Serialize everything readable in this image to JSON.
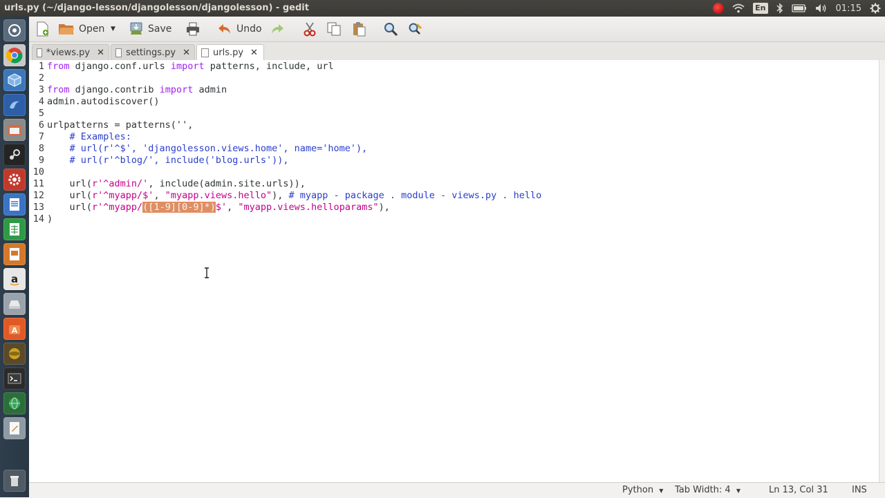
{
  "window": {
    "title": "urls.py (~/django-lesson/djangolesson/djangolesson) - gedit"
  },
  "tray": {
    "keyboard_layout": "En",
    "clock": "01:15",
    "icons": [
      "record-icon",
      "wifi-icon",
      "keyboard-icon",
      "bluetooth-icon",
      "battery-icon",
      "volume-icon",
      "power-gear-icon"
    ]
  },
  "toolbar": {
    "open_label": "Open",
    "save_label": "Save",
    "undo_label": "Undo"
  },
  "tabs": [
    {
      "label": "*views.py",
      "close": "✕"
    },
    {
      "label": "settings.py",
      "close": "✕"
    },
    {
      "label": "urls.py",
      "close": "✕"
    }
  ],
  "editor": {
    "lines": [
      {
        "n": "1",
        "segments": [
          [
            "kw",
            "from"
          ],
          [
            "",
            "django.conf.urls"
          ],
          [
            "kw",
            "import"
          ],
          [
            "",
            "patterns, include, url"
          ]
        ]
      },
      {
        "n": "2",
        "segments": []
      },
      {
        "n": "3",
        "segments": [
          [
            "kw",
            "from"
          ],
          [
            "",
            "django.contrib"
          ],
          [
            "kw",
            "import"
          ],
          [
            "",
            "admin"
          ]
        ]
      },
      {
        "n": "4",
        "segments": [
          [
            "",
            "admin.autodiscover()"
          ]
        ]
      },
      {
        "n": "5",
        "segments": []
      },
      {
        "n": "6",
        "segments": [
          [
            "",
            "urlpatterns = patterns(''",
            ""
          ]
        ]
      },
      {
        "n": "7",
        "segments": [
          [
            "cm",
            "# Examples:"
          ]
        ]
      },
      {
        "n": "8",
        "segments": [
          [
            "cm",
            "# url(r'^$', 'djangolesson.views.home', name='home'),"
          ]
        ]
      },
      {
        "n": "9",
        "segments": [
          [
            "cm",
            "# url(r'^blog/', include('blog.urls')),"
          ]
        ]
      },
      {
        "n": "10",
        "segments": []
      },
      {
        "n": "11",
        "segments": [
          [
            "",
            "url("
          ],
          [
            "str",
            "r'^admin/'"
          ],
          [
            "",
            ", include(admin.site.urls)),"
          ]
        ]
      },
      {
        "n": "12",
        "segments": [
          [
            "",
            "url("
          ],
          [
            "str",
            "r'^myapp/$'"
          ],
          [
            "",
            ", "
          ],
          [
            "str",
            "\"myapp.views.hello\""
          ],
          [
            "",
            "), "
          ],
          [
            "cm",
            "# myapp - package . module - views.py . hello"
          ]
        ]
      },
      {
        "n": "13",
        "segments": [
          [
            "",
            "url("
          ],
          [
            "str",
            "r'^myapp/"
          ],
          [
            "hl",
            "([1-9][0-9]*)"
          ],
          [
            "str",
            "$'"
          ],
          [
            "",
            ", "
          ],
          [
            "str",
            "\"myapp.views.helloparams\""
          ],
          [
            "",
            "),"
          ]
        ]
      },
      {
        "n": "14",
        "segments": [
          [
            "",
            ")"
          ]
        ]
      }
    ]
  },
  "status": {
    "language": "Python",
    "tab_width": "Tab Width: 4",
    "position": "Ln 13, Col 31",
    "mode": "INS"
  },
  "colors": {
    "keyword": "#a020f0",
    "string": "#c4008c",
    "comment": "#2a3dcc",
    "bracket_highlight": "#e08e62"
  }
}
